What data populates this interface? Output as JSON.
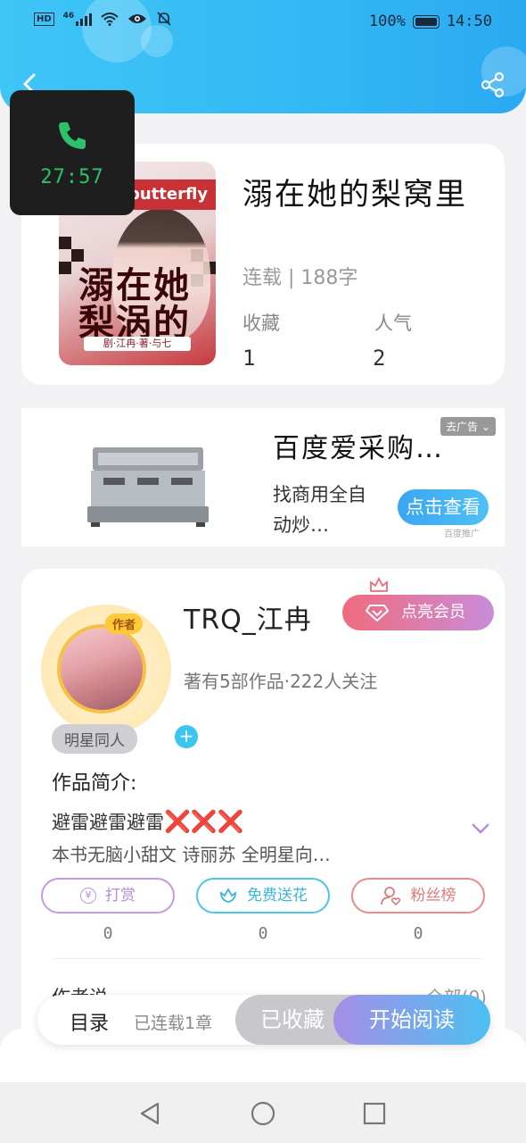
{
  "status_bar": {
    "network": "46",
    "battery": "100%",
    "time": "14:50"
  },
  "call": {
    "duration": "27:57"
  },
  "book": {
    "cover_band": "butterfly",
    "cover_title_line1": "溺在她",
    "cover_title_line2": "梨涡的",
    "cover_author": "剧·江冉·著·与七",
    "title": "溺在她的梨窝里",
    "status": "连载 | 188字",
    "favorites_label": "收藏",
    "favorites_value": "1",
    "popularity_label": "人气",
    "popularity_value": "2"
  },
  "ad": {
    "title": "百度爱采购…",
    "description": "找商用全自动炒…",
    "tag": "去广告",
    "cta": "点击查看",
    "cta_sub": "百度推广"
  },
  "author": {
    "badge": "作者",
    "name": "TRQ_江冉",
    "vip_button": "点亮会员",
    "meta": "著有5部作品·222人关注",
    "tag": "明星同人",
    "tag_add": "+",
    "intro_label": "作品简介:",
    "intro_line1": "避雷避雷避雷",
    "intro_marks": "❌❌❌",
    "intro_line2": "本书无脑小甜文  诗丽苏  全明星向…"
  },
  "actions": [
    {
      "label": "打赏",
      "count": "0"
    },
    {
      "label": "免费送花",
      "count": "0"
    },
    {
      "label": "粉丝榜",
      "count": "0"
    }
  ],
  "next_section": {
    "label": "作者说",
    "right": "全部(0)"
  },
  "bottom_bar": {
    "toc_label": "目录",
    "toc_sub": "已连载1章",
    "collected": "已收藏",
    "read": "开始阅读"
  },
  "colors": {
    "header": "#33b8f4",
    "accent_blue": "#3cc6ef",
    "vip_start": "#f06b7d",
    "vip_end": "#c98cd9",
    "reward": "#c59ae0",
    "flower": "#4cc6e6",
    "fans": "#ec8a8a"
  }
}
